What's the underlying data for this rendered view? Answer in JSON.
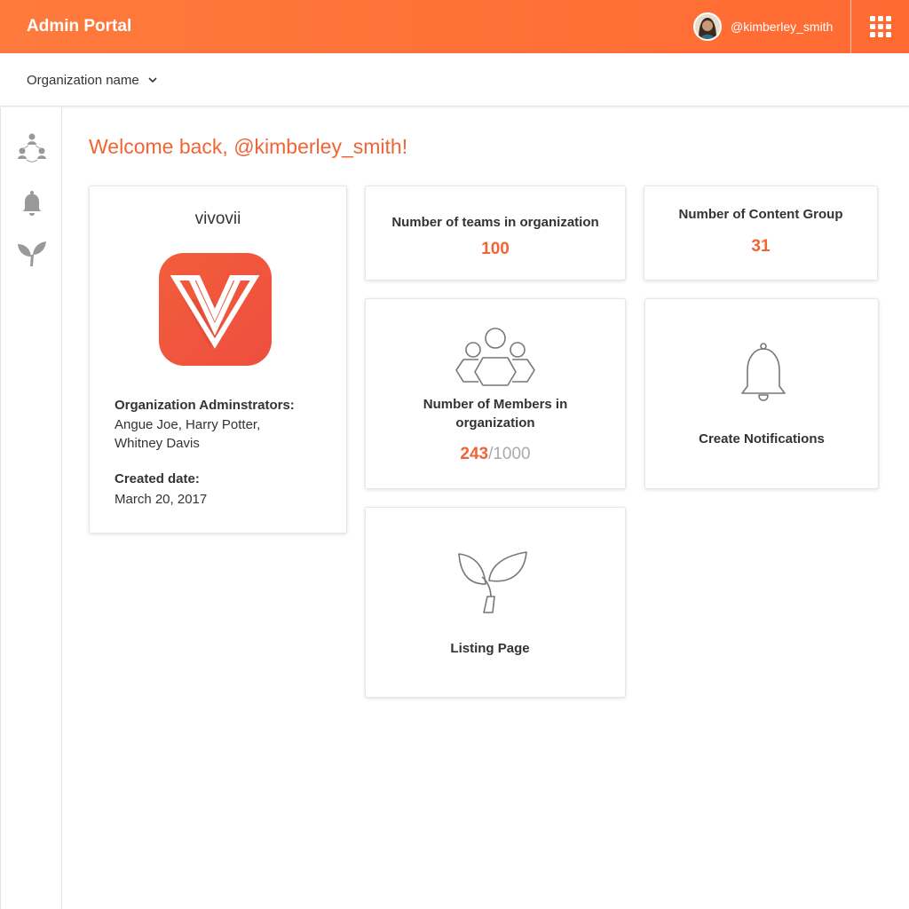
{
  "header": {
    "app_title": "Admin Portal",
    "username": "@kimberley_smith",
    "brand_color": "#ff6c34"
  },
  "org_bar": {
    "selector_label": "Organization name"
  },
  "sidebar": {
    "items": [
      {
        "icon": "network-icon"
      },
      {
        "icon": "bell-icon"
      },
      {
        "icon": "sprout-icon"
      }
    ]
  },
  "main": {
    "welcome": "Welcome back, @kimberley_smith!",
    "org_card": {
      "name": "vivovii",
      "admins_label": "Organization Adminstrators:",
      "admins_line1": "Angue Joe, Harry Potter,",
      "admins_line2": "Whitney Davis",
      "created_label": "Created date:",
      "created_value": "March 20, 2017"
    },
    "teams_card": {
      "title": "Number of teams in organization",
      "value": "100"
    },
    "content_card": {
      "title": "Number of Content Group",
      "value": "31"
    },
    "members_card": {
      "title_line1": "Number of Members in",
      "title_line2": "organization",
      "value": "243",
      "total": "/1000"
    },
    "notifications_card": {
      "title": "Create Notifications"
    },
    "listing_card": {
      "title": "Listing Page"
    }
  }
}
